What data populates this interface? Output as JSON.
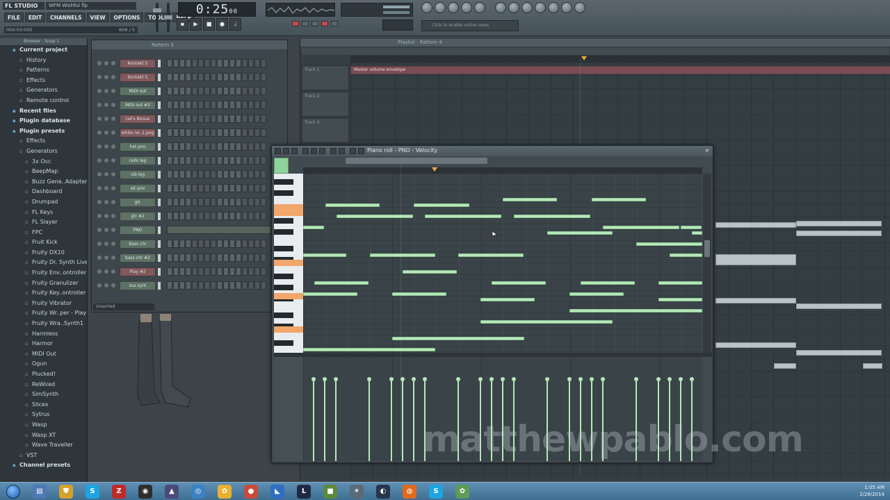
{
  "app": {
    "badge": "FL STUDIO",
    "project": "WFM Wishful flp",
    "menu": [
      "FILE",
      "EDIT",
      "CHANNELS",
      "VIEW",
      "OPTIONS",
      "TOOLS",
      "HELP"
    ],
    "hint_left": "004:03:000",
    "hint_right": "606 / 5",
    "time_main": "0:25",
    "time_sub": "00",
    "hint_field": "Click to enable online news"
  },
  "browser": {
    "header": "Browser - Snap 1",
    "items": [
      {
        "label": "Current project",
        "level": 0,
        "icon": "folder-icon"
      },
      {
        "label": "History",
        "level": 1,
        "icon": "folder-icon"
      },
      {
        "label": "Patterns",
        "level": 1,
        "icon": "folder-icon"
      },
      {
        "label": "Effects",
        "level": 1,
        "icon": "folder-icon"
      },
      {
        "label": "Generators",
        "level": 1,
        "icon": "folder-icon"
      },
      {
        "label": "Remote control",
        "level": 1,
        "icon": "folder-icon"
      },
      {
        "label": "Recent files",
        "level": 0,
        "icon": "folder-icon"
      },
      {
        "label": "Plugin database",
        "level": 0,
        "icon": "folder-icon"
      },
      {
        "label": "Plugin presets",
        "level": 0,
        "icon": "folder-icon"
      },
      {
        "label": "Effects",
        "level": 1,
        "icon": "folder-icon"
      },
      {
        "label": "Generators",
        "level": 1,
        "icon": "folder-icon"
      },
      {
        "label": "3x Osc",
        "level": 2,
        "icon": "folder-icon"
      },
      {
        "label": "BeepMap",
        "level": 2,
        "icon": "folder-icon"
      },
      {
        "label": "Buzz Gene..Adapter",
        "level": 2,
        "icon": "folder-icon"
      },
      {
        "label": "Dashboard",
        "level": 2,
        "icon": "folder-icon"
      },
      {
        "label": "Drumpad",
        "level": 2,
        "icon": "folder-icon"
      },
      {
        "label": "FL Keys",
        "level": 2,
        "icon": "folder-icon"
      },
      {
        "label": "FL Slayer",
        "level": 2,
        "icon": "folder-icon"
      },
      {
        "label": "FPC",
        "level": 2,
        "icon": "folder-icon"
      },
      {
        "label": "Fruit Kick",
        "level": 2,
        "icon": "folder-icon"
      },
      {
        "label": "Fruity DX10",
        "level": 2,
        "icon": "folder-icon"
      },
      {
        "label": "Fruity Dr. Synth Live",
        "level": 2,
        "icon": "folder-icon"
      },
      {
        "label": "Fruity Env..ontroller",
        "level": 2,
        "icon": "folder-icon"
      },
      {
        "label": "Fruity Granulizer",
        "level": 2,
        "icon": "folder-icon"
      },
      {
        "label": "Fruity Key..ontroller",
        "level": 2,
        "icon": "folder-icon"
      },
      {
        "label": "Fruity Vibrator",
        "level": 2,
        "icon": "folder-icon"
      },
      {
        "label": "Fruity Wr..per - Play",
        "level": 2,
        "icon": "folder-icon"
      },
      {
        "label": "Fruity Wra..Synth1",
        "level": 2,
        "icon": "folder-icon"
      },
      {
        "label": "Harmless",
        "level": 2,
        "icon": "folder-icon"
      },
      {
        "label": "Harmor",
        "level": 2,
        "icon": "folder-icon"
      },
      {
        "label": "MIDI Out",
        "level": 2,
        "icon": "folder-icon"
      },
      {
        "label": "Ogun",
        "level": 2,
        "icon": "folder-icon"
      },
      {
        "label": "Plucked!",
        "level": 2,
        "icon": "folder-icon"
      },
      {
        "label": "ReWired",
        "level": 2,
        "icon": "folder-icon"
      },
      {
        "label": "SimSynth",
        "level": 2,
        "icon": "folder-icon"
      },
      {
        "label": "Slicex",
        "level": 2,
        "icon": "folder-icon"
      },
      {
        "label": "Sytrus",
        "level": 2,
        "icon": "folder-icon"
      },
      {
        "label": "Wasp",
        "level": 2,
        "icon": "folder-icon"
      },
      {
        "label": "Wasp XT",
        "level": 2,
        "icon": "folder-icon"
      },
      {
        "label": "Wave Traveller",
        "level": 2,
        "icon": "folder-icon"
      },
      {
        "label": "VST",
        "level": 1,
        "icon": "folder-icon"
      },
      {
        "label": "Channel presets",
        "level": 0,
        "icon": "folder-icon"
      }
    ]
  },
  "channel_rack": {
    "title": "Pattern 3",
    "footer": "Unsorted",
    "channels": [
      {
        "name": "Kontakt 5",
        "color": "red"
      },
      {
        "name": "Kontakt 5",
        "color": "red"
      },
      {
        "name": "MIDI out",
        "color": "green"
      },
      {
        "name": "MIDI out #2",
        "color": "green"
      },
      {
        "name": "LeFx Bonus",
        "color": "red"
      },
      {
        "name": "white no..1.pog",
        "color": "red"
      },
      {
        "name": "hat pno",
        "color": "green"
      },
      {
        "name": "cello leg",
        "color": "green"
      },
      {
        "name": "vib leg",
        "color": "green"
      },
      {
        "name": "alt pno",
        "color": "green"
      },
      {
        "name": "gtr",
        "color": "green"
      },
      {
        "name": "gtr #2",
        "color": "green"
      },
      {
        "name": "PNO",
        "color": "green"
      },
      {
        "name": "Bass chr",
        "color": "green"
      },
      {
        "name": "bass chr #2",
        "color": "green"
      },
      {
        "name": "Play #2",
        "color": "red"
      },
      {
        "name": "sus synt",
        "color": "green"
      }
    ]
  },
  "playlist": {
    "title": "Playlist - Pattern 4",
    "automation_clip": "Master volume envelope",
    "tracks": [
      "Track 1",
      "Track 2",
      "Track 3"
    ]
  },
  "piano_roll": {
    "title": "Piano roll - PNO - Velocity",
    "close": "×"
  },
  "watermark": "matthewpablo.com",
  "taskbar": {
    "time": "1:05 AM",
    "date": "2/28/2014",
    "apps": [
      {
        "icon": "start-icon",
        "glyph": ""
      },
      {
        "icon": "explorer-icon",
        "glyph": "▤",
        "color": "#4f78b4"
      },
      {
        "icon": "shield-icon",
        "glyph": "⛊",
        "color": "#d4a22a"
      },
      {
        "icon": "skype-icon",
        "glyph": "S",
        "color": "#1ea4e0"
      },
      {
        "icon": "filezilla-icon",
        "glyph": "Z",
        "color": "#bf2a2a"
      },
      {
        "icon": "obs-icon",
        "glyph": "◉",
        "color": "#2e2e2e"
      },
      {
        "icon": "ableton-icon",
        "glyph": "▲",
        "color": "#4a4a7a"
      },
      {
        "icon": "app-icon",
        "glyph": "◎",
        "color": "#3c82c2"
      },
      {
        "icon": "fl-studio-icon",
        "glyph": "✿",
        "color": "#e9b030"
      },
      {
        "icon": "app-red-icon",
        "glyph": "●",
        "color": "#c84a3a"
      },
      {
        "icon": "app-blue-icon",
        "glyph": "◣",
        "color": "#2f6fc0"
      },
      {
        "icon": "league-icon",
        "glyph": "L",
        "color": "#1f2a44"
      },
      {
        "icon": "minecraft-icon",
        "glyph": "■",
        "color": "#5b8a3c"
      },
      {
        "icon": "app-gear-icon",
        "glyph": "✶",
        "color": "#5a6a78"
      },
      {
        "icon": "steam-icon",
        "glyph": "◐",
        "color": "#27364a"
      },
      {
        "icon": "firefox-icon",
        "glyph": "◍",
        "color": "#e06a1e"
      },
      {
        "icon": "skype2-icon",
        "glyph": "S",
        "color": "#1ea4e0"
      },
      {
        "icon": "fl-icon",
        "glyph": "✿",
        "color": "#5f9a56"
      }
    ]
  }
}
